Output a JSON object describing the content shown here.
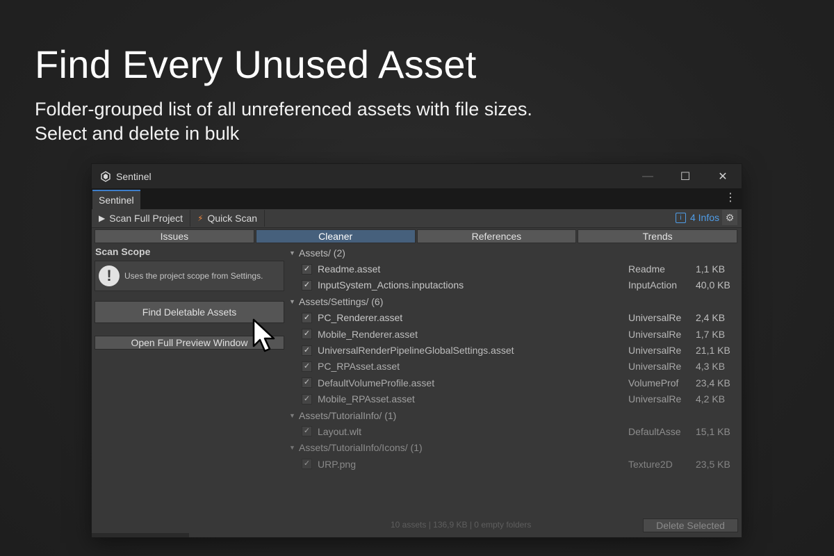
{
  "hero": {
    "title": "Find Every Unused Asset",
    "subtitle_line1": "Folder-grouped list of all unreferenced assets with file sizes.",
    "subtitle_line2": "Select and delete in bulk"
  },
  "window": {
    "title": "Sentinel",
    "tab_label": "Sentinel",
    "minimize": "—",
    "maximize": "☐",
    "close": "✕"
  },
  "toolbar": {
    "scan_full_label": "Scan Full Project",
    "quick_scan_label": "Quick Scan",
    "info_icon_letter": "i",
    "info_count": "4 Infos"
  },
  "view_tabs": [
    "Issues",
    "Cleaner",
    "References",
    "Trends"
  ],
  "left": {
    "scope_title": "Scan Scope",
    "scope_text": "Uses the project scope from Settings.",
    "find_button": "Find Deletable Assets",
    "open_preview_button": "Open Full Preview Window"
  },
  "groups": [
    {
      "label": "Assets/ (2)",
      "items": [
        {
          "name": "Readme.asset",
          "type": "Readme",
          "size": "1,1 KB"
        },
        {
          "name": "InputSystem_Actions.inputactions",
          "type": "InputAction",
          "size": "40,0 KB"
        }
      ]
    },
    {
      "label": "Assets/Settings/ (6)",
      "items": [
        {
          "name": "PC_Renderer.asset",
          "type": "UniversalRe",
          "size": "2,4 KB"
        },
        {
          "name": "Mobile_Renderer.asset",
          "type": "UniversalRe",
          "size": "1,7 KB"
        },
        {
          "name": "UniversalRenderPipelineGlobalSettings.asset",
          "type": "UniversalRe",
          "size": "21,1 KB"
        },
        {
          "name": "PC_RPAsset.asset",
          "type": "UniversalRe",
          "size": "4,3 KB"
        },
        {
          "name": "DefaultVolumeProfile.asset",
          "type": "VolumeProf",
          "size": "23,4 KB"
        },
        {
          "name": "Mobile_RPAsset.asset",
          "type": "UniversalRe",
          "size": "4,2 KB"
        }
      ]
    },
    {
      "label": "Assets/TutorialInfo/ (1)",
      "items": [
        {
          "name": "Layout.wlt",
          "type": "DefaultAsse",
          "size": "15,1 KB"
        }
      ]
    },
    {
      "label": "Assets/TutorialInfo/Icons/ (1)",
      "items": [
        {
          "name": "URP.png",
          "type": "Texture2D",
          "size": "23,5 KB"
        }
      ]
    }
  ],
  "footer": {
    "status": "10 assets | 136,9 KB | 0 empty folders",
    "delete_button": "Delete Selected"
  },
  "colors": {
    "accent_blue": "#4f9de8",
    "active_tab": "#46607c",
    "quick_scan_bolt": "#f0883e"
  }
}
